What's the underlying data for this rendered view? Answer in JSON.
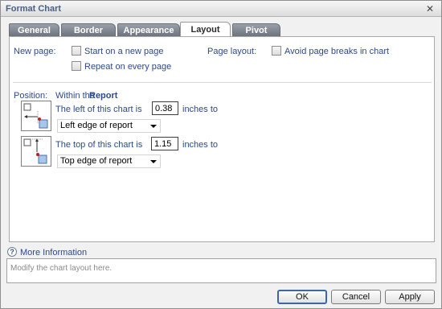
{
  "window": {
    "title": "Format Chart",
    "close_glyph": "✕"
  },
  "tabs": [
    {
      "label": "General"
    },
    {
      "label": "Border"
    },
    {
      "label": "Appearance"
    },
    {
      "label": "Layout",
      "active": true
    },
    {
      "label": "Pivot"
    }
  ],
  "layout": {
    "new_page_label": "New page:",
    "start_new_page": {
      "label": "Start on a new page",
      "checked": false
    },
    "repeat_every_page": {
      "label": "Repeat on every page",
      "checked": false
    },
    "page_layout_label": "Page layout:",
    "avoid_page_breaks": {
      "label": "Avoid page breaks in chart",
      "checked": false
    },
    "position_label": "Position:",
    "within_prefix": "Within the",
    "within_target": "Report",
    "left": {
      "prefix": "The left of this chart is",
      "value": "0.38",
      "suffix": "inches to",
      "selected": "Left edge of report"
    },
    "top": {
      "prefix": "The top of this chart is",
      "value": "1.15",
      "suffix": "inches to",
      "selected": "Top edge of report"
    }
  },
  "info": {
    "icon": "help-icon",
    "link_label": "More Information",
    "text": "Modify the chart layout here."
  },
  "buttons": {
    "ok": "OK",
    "cancel": "Cancel",
    "apply": "Apply"
  },
  "colors": {
    "label_text": "#2c4a86",
    "tab_inactive": "#7b818c",
    "default_button_border": "#3f64a8",
    "icon_red": "#c0201b",
    "icon_blue": "#a9c6ea"
  }
}
